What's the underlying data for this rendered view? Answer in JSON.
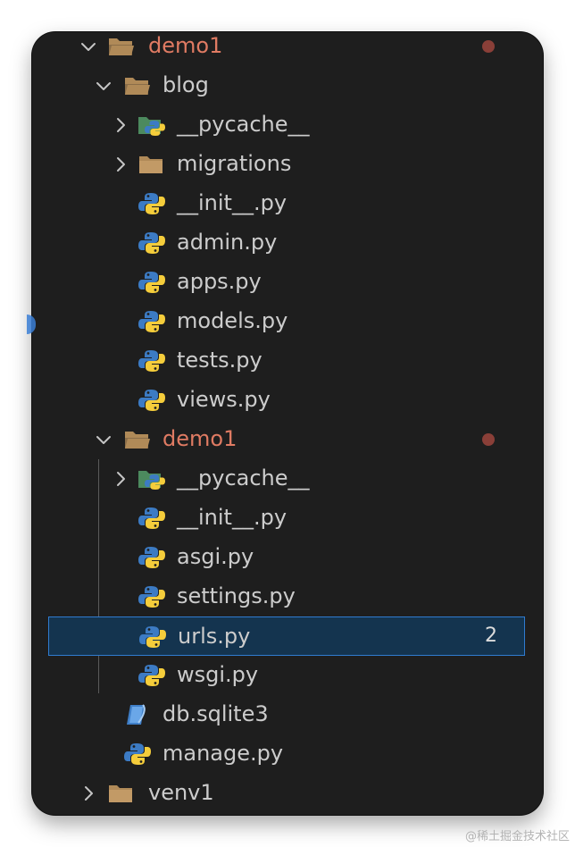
{
  "tree": {
    "items": [
      {
        "label": "demo1",
        "kind": "folder",
        "expanded": true,
        "modified": true,
        "depth": 0
      },
      {
        "label": "blog",
        "kind": "folder",
        "expanded": true,
        "depth": 1
      },
      {
        "label": "__pycache__",
        "kind": "pycache-folder",
        "expanded": false,
        "depth": 2
      },
      {
        "label": "migrations",
        "kind": "folder",
        "expanded": false,
        "depth": 2
      },
      {
        "label": "__init__.py",
        "kind": "python",
        "depth": 2
      },
      {
        "label": "admin.py",
        "kind": "python",
        "depth": 2
      },
      {
        "label": "apps.py",
        "kind": "python",
        "depth": 2
      },
      {
        "label": "models.py",
        "kind": "python",
        "depth": 2
      },
      {
        "label": "tests.py",
        "kind": "python",
        "depth": 2
      },
      {
        "label": "views.py",
        "kind": "python",
        "depth": 2
      },
      {
        "label": "demo1",
        "kind": "folder",
        "expanded": true,
        "modified": true,
        "depth": 1
      },
      {
        "label": "__pycache__",
        "kind": "pycache-folder",
        "expanded": false,
        "depth": 2
      },
      {
        "label": "__init__.py",
        "kind": "python",
        "depth": 2
      },
      {
        "label": "asgi.py",
        "kind": "python",
        "depth": 2
      },
      {
        "label": "settings.py",
        "kind": "python",
        "depth": 2
      },
      {
        "label": "urls.py",
        "kind": "python",
        "depth": 2,
        "selected": true,
        "badge": "2"
      },
      {
        "label": "wsgi.py",
        "kind": "python",
        "depth": 2
      },
      {
        "label": "db.sqlite3",
        "kind": "sqlite",
        "depth": 1
      },
      {
        "label": "manage.py",
        "kind": "python",
        "depth": 1
      },
      {
        "label": "venv1",
        "kind": "folder",
        "expanded": false,
        "depth": 0
      }
    ]
  },
  "colors": {
    "background": "#1e1e1e",
    "text": "#cccccc",
    "modified_text": "#e07b63",
    "modified_dot": "#8a3f38",
    "selection_bg": "#14344f",
    "selection_border": "#2f7bd0",
    "folder": "#b08a58",
    "python_blue": "#3c7bc4",
    "python_yellow": "#f5cd3b"
  },
  "watermark": "@稀土掘金技术社区"
}
